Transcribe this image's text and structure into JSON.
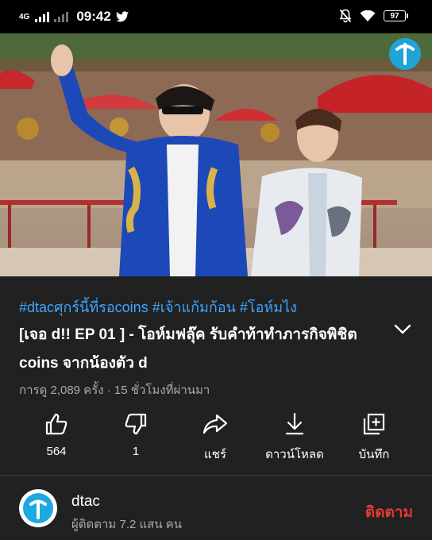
{
  "status_bar": {
    "network": "4G",
    "time": "09:42",
    "battery": "97"
  },
  "video": {
    "hashtags": "#dtacศุกร์นี้ที่รอcoins #เจ้าแก้มก้อน #โอห์มไง",
    "title": "[เจอ d!! EP 01 ] - โอห์มฟลุ๊ค รับคำท้าทำภารกิจพิชิต coins จากน้องตัว d",
    "meta": "การดู 2,089 ครั้ง · 15 ชั่วโมงที่ผ่านมา"
  },
  "actions": {
    "like": "564",
    "dislike": "1",
    "share": "แชร์",
    "download": "ดาวน์โหลด",
    "save": "บันทึก"
  },
  "channel": {
    "name": "dtac",
    "subscribers": "ผู้ติดตาม 7.2 แสน คน",
    "subscribe_label": "ติดตาม"
  },
  "colors": {
    "background": "#212121",
    "hashtag": "#3ea6ff",
    "subscribe": "#e53935",
    "brand": "#1ca8e0"
  }
}
